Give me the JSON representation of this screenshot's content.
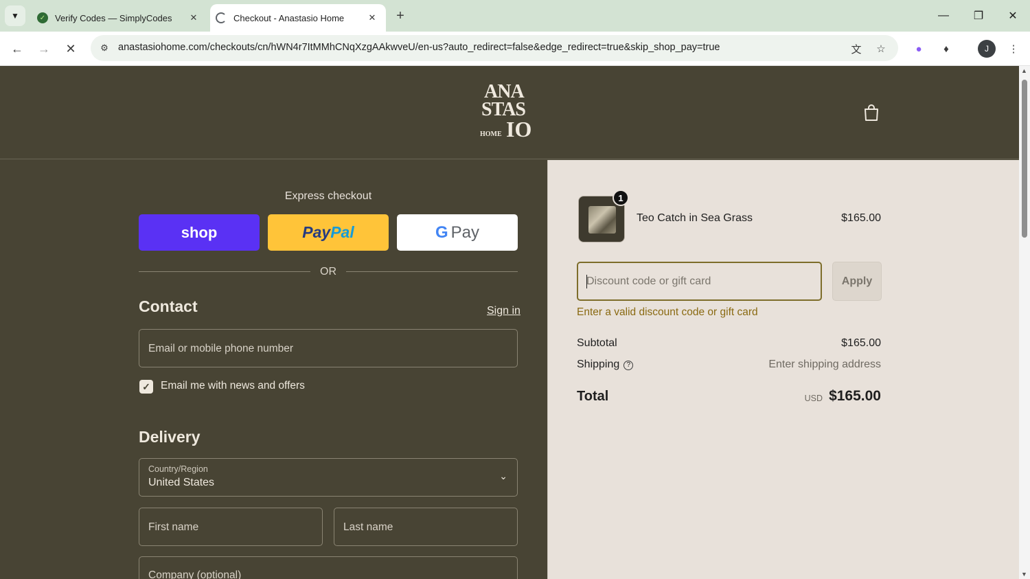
{
  "browser": {
    "tabs": [
      {
        "title": "Verify Codes — SimplyCodes",
        "active": false,
        "favicon": "simplycodes-icon"
      },
      {
        "title": "Checkout - Anastasio Home",
        "active": true,
        "favicon": "loading-icon"
      }
    ],
    "url": "anastasiohome.com/checkouts/cn/hWN4r7ItMMhCNqXzgAAkwveU/en-us?auto_redirect=false&edge_redirect=true&skip_shop_pay=true",
    "avatar_letter": "J"
  },
  "header": {
    "logo_lines": [
      "ANA",
      "STAS",
      "IO"
    ],
    "logo_small": "HOME"
  },
  "express": {
    "title": "Express checkout",
    "shop_label": "shop",
    "paypal_part1": "Pay",
    "paypal_part2": "Pal",
    "gpay_g": "G",
    "gpay_label": "Pay",
    "or_label": "OR"
  },
  "contact": {
    "title": "Contact",
    "signin_label": "Sign in",
    "email_placeholder": "Email or mobile phone number",
    "newsletter_label": "Email me with news and offers",
    "newsletter_checked": true
  },
  "delivery": {
    "title": "Delivery",
    "country_label": "Country/Region",
    "country_value": "United States",
    "first_name_placeholder": "First name",
    "last_name_placeholder": "Last name",
    "company_placeholder": "Company (optional)"
  },
  "summary": {
    "product_name": "Teo Catch in Sea Grass",
    "product_price": "$165.00",
    "quantity": "1",
    "discount_placeholder": "Discount code or gift card",
    "apply_label": "Apply",
    "discount_error": "Enter a valid discount code or gift card",
    "subtotal_label": "Subtotal",
    "subtotal_value": "$165.00",
    "shipping_label": "Shipping",
    "shipping_value": "Enter shipping address",
    "total_label": "Total",
    "total_currency": "USD",
    "total_value": "$165.00"
  },
  "colors": {
    "page_bg": "#484434",
    "summary_bg": "#e8e1da",
    "shop_pay": "#5a31f4",
    "paypal": "#ffc439",
    "error": "#8a6a12"
  }
}
